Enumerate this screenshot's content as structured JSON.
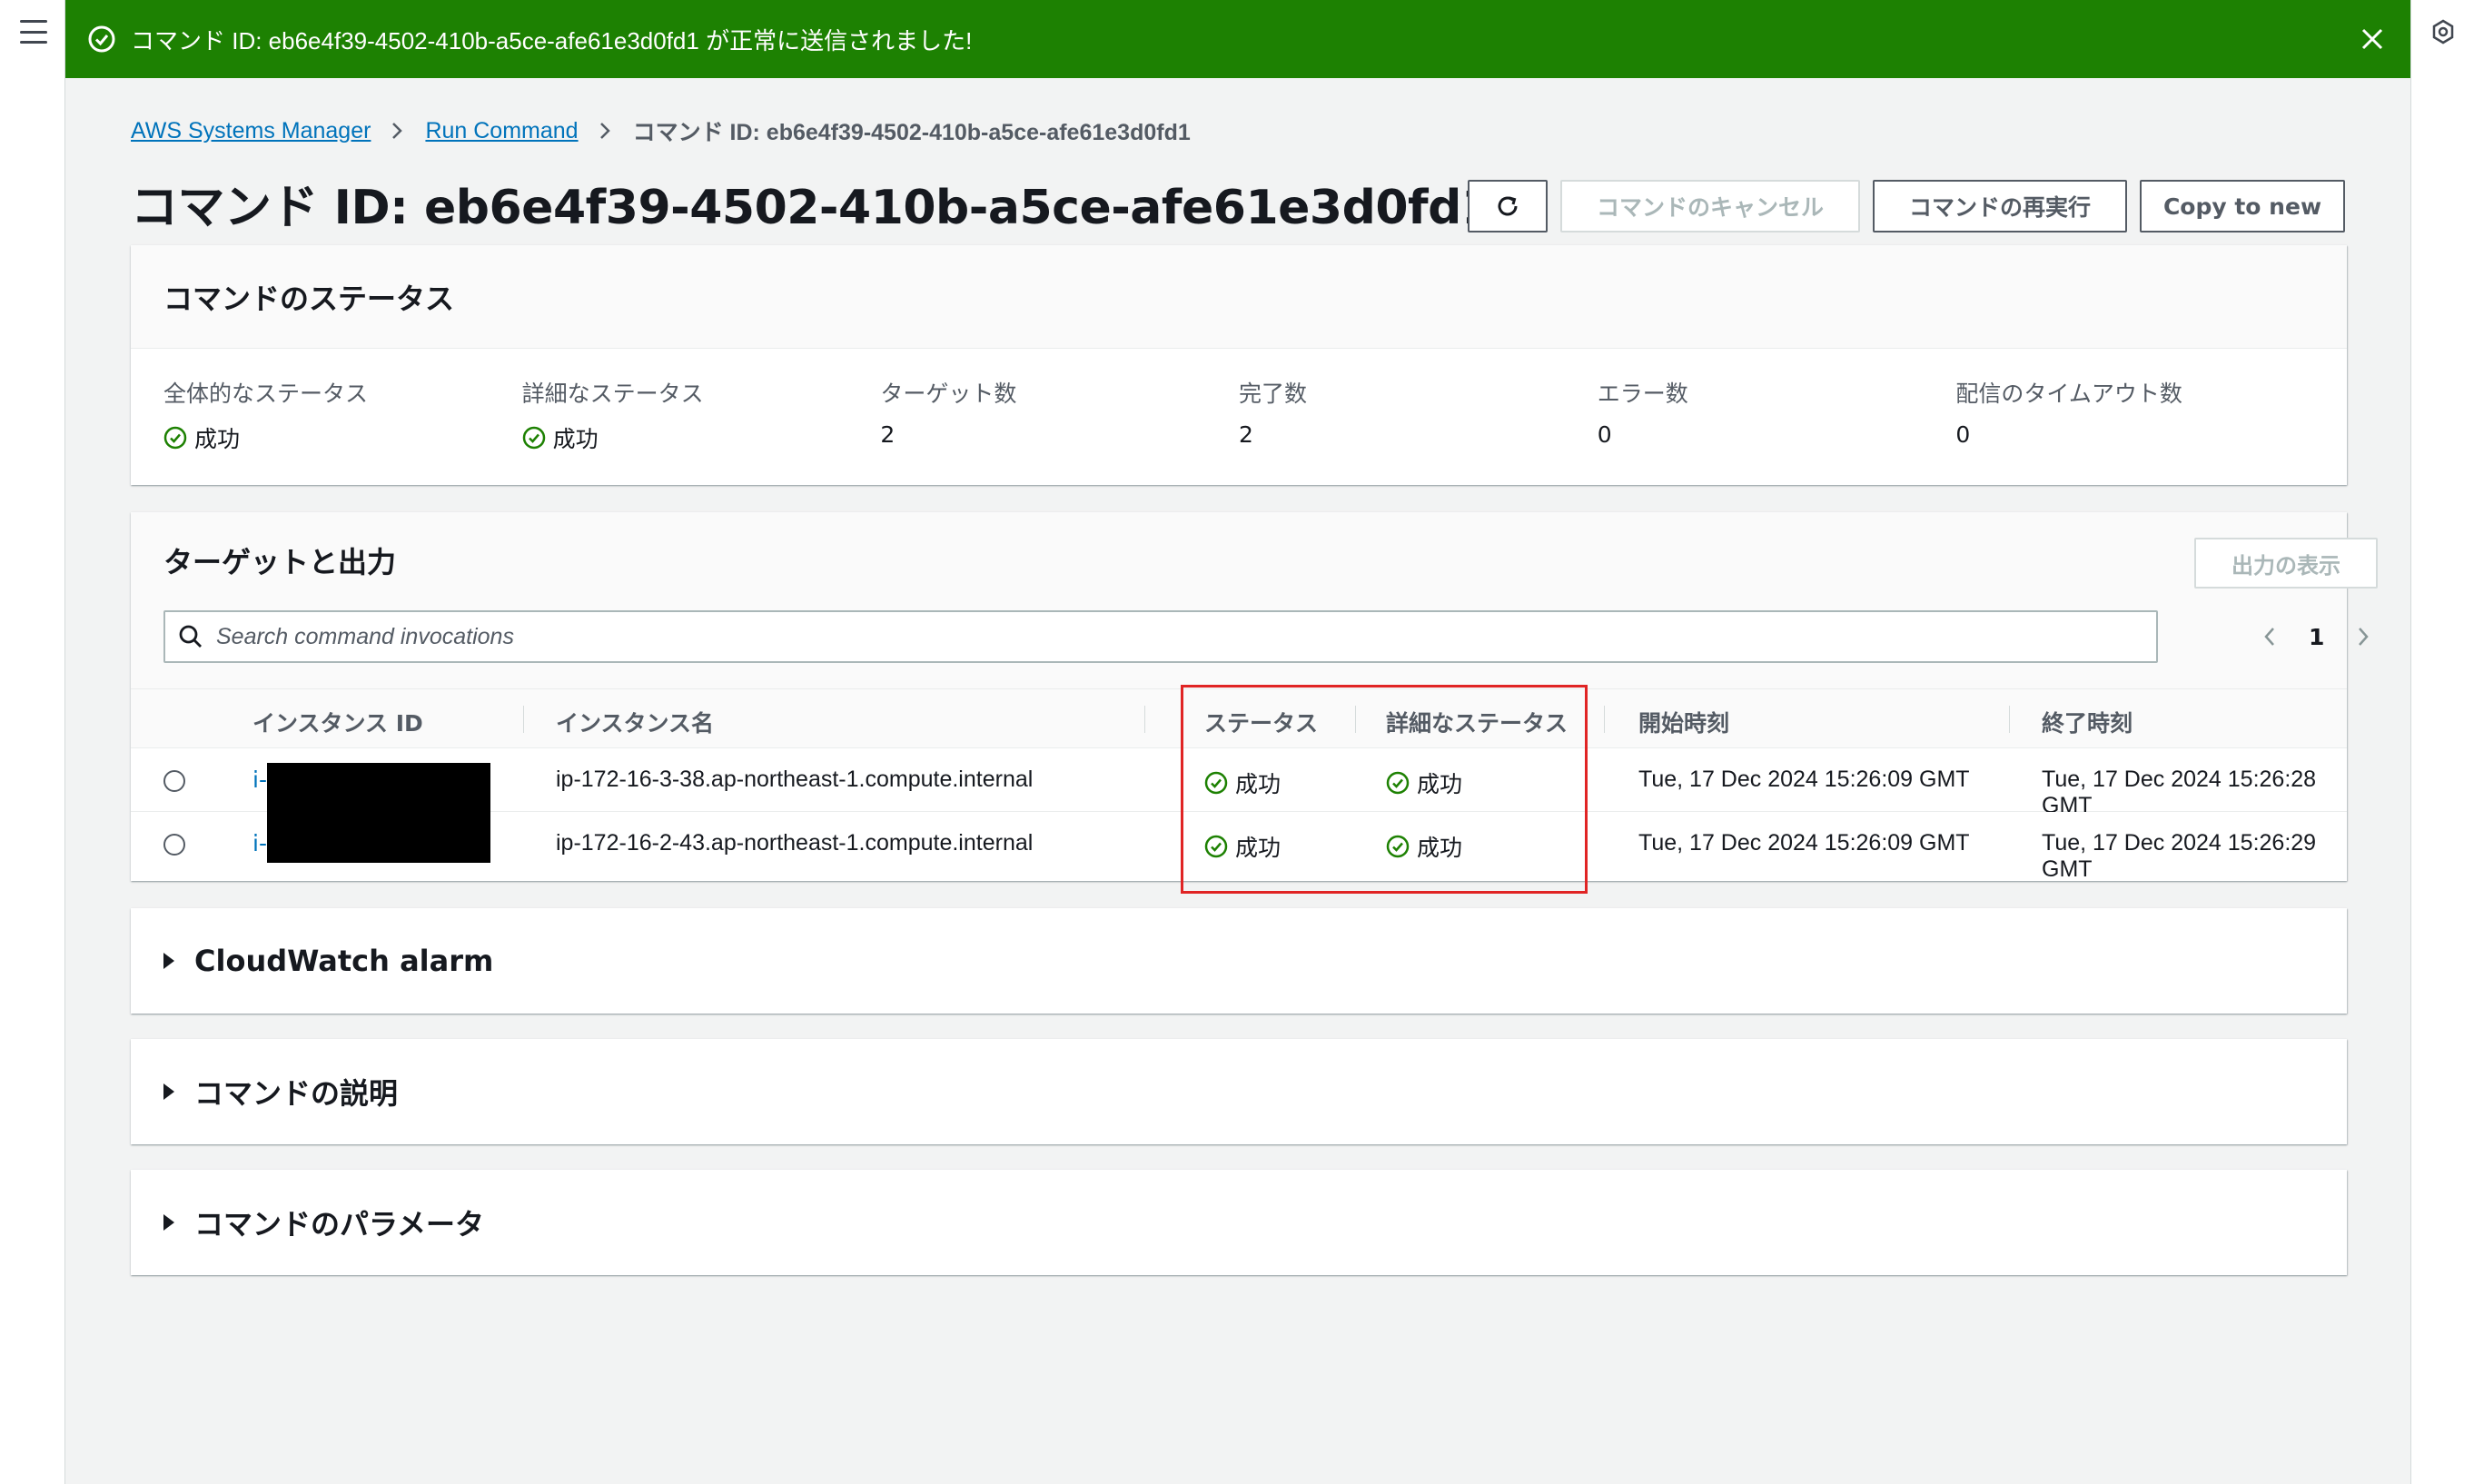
{
  "flash": {
    "message": "コマンド ID: eb6e4f39-4502-410b-a5ce-afe61e3d0fd1 が正常に送信されました!"
  },
  "breadcrumb": {
    "root": "AWS Systems Manager",
    "parent": "Run Command",
    "current": "コマンド ID: eb6e4f39-4502-410b-a5ce-afe61e3d0fd1"
  },
  "page": {
    "title": "コマンド ID: eb6e4f39-4502-410b-a5ce-afe61e3d0fd1"
  },
  "actions": {
    "cancel": "コマンドのキャンセル",
    "rerun": "コマンドの再実行",
    "copy": "Copy to new"
  },
  "status": {
    "header": "コマンドのステータス",
    "overall_label": "全体的なステータス",
    "overall_value": "成功",
    "detailed_label": "詳細なステータス",
    "detailed_value": "成功",
    "targets_label": "ターゲット数",
    "targets_value": "2",
    "completed_label": "完了数",
    "completed_value": "2",
    "errors_label": "エラー数",
    "errors_value": "0",
    "timeouts_label": "配信のタイムアウト数",
    "timeouts_value": "0"
  },
  "targets": {
    "header": "ターゲットと出力",
    "output_button": "出力の表示",
    "search_placeholder": "Search command invocations",
    "page": "1",
    "columns": {
      "instance_id": "インスタンス ID",
      "instance_name": "インスタンス名",
      "status": "ステータス",
      "detailed_status": "詳細なステータス",
      "start": "開始時刻",
      "end": "終了時刻"
    },
    "rows": [
      {
        "instance_id": "i-",
        "instance_name": "ip-172-16-3-38.ap-northeast-1.compute.internal",
        "status": "成功",
        "detailed_status": "成功",
        "start": "Tue, 17 Dec 2024 15:26:09 GMT",
        "end": "Tue, 17 Dec 2024 15:26:28 GMT"
      },
      {
        "instance_id": "i-",
        "instance_name": "ip-172-16-2-43.ap-northeast-1.compute.internal",
        "status": "成功",
        "detailed_status": "成功",
        "start": "Tue, 17 Dec 2024 15:26:09 GMT",
        "end": "Tue, 17 Dec 2024 15:26:29 GMT"
      }
    ]
  },
  "sections": {
    "cloudwatch": "CloudWatch alarm",
    "description": "コマンドの説明",
    "parameters": "コマンドのパラメータ"
  },
  "colors": {
    "success": "#1d8102",
    "link": "#0073bb",
    "highlight": "#e02424"
  }
}
